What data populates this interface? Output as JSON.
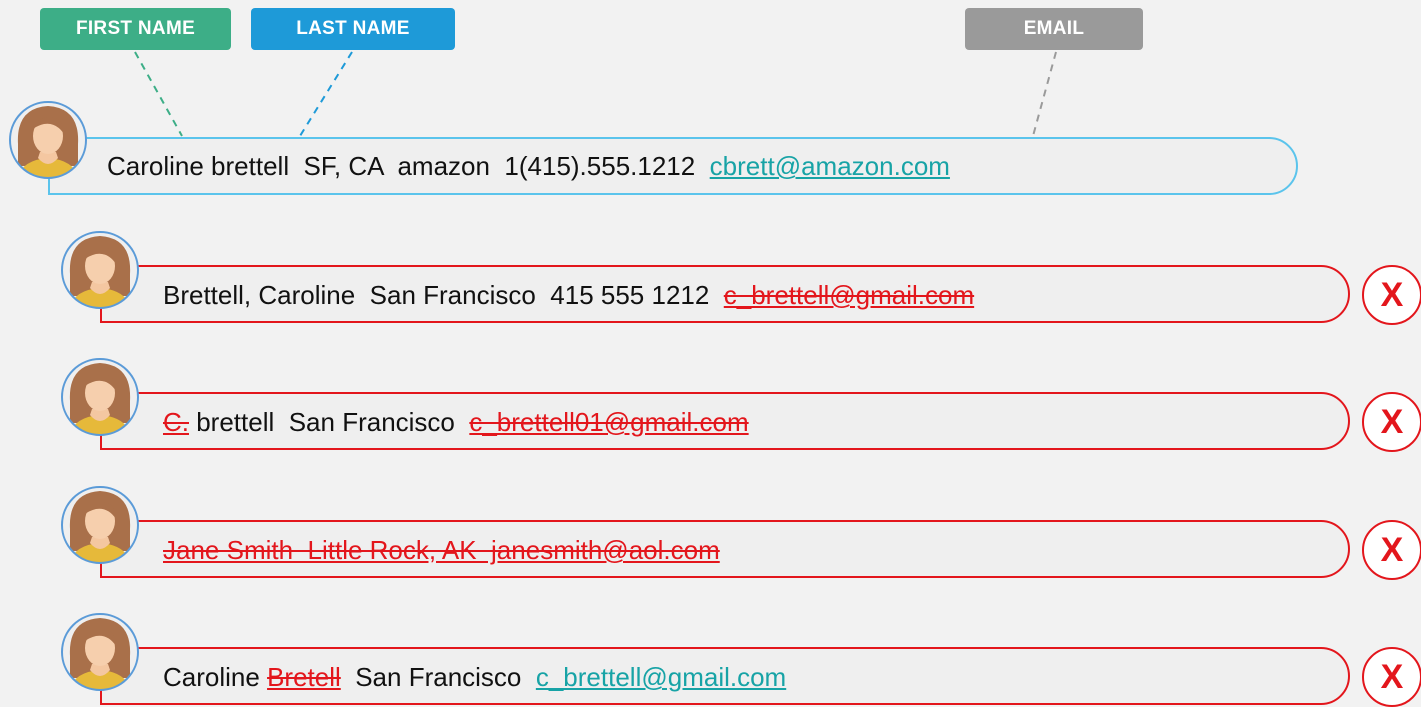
{
  "tags": {
    "first": "FIRST NAME",
    "last": "LAST NAME",
    "email": "EMAIL"
  },
  "colors": {
    "first_tag": "#3dae87",
    "last_tag": "#1e9ad8",
    "email_tag": "#9a9a9a",
    "main_border": "#5bc4ec",
    "reject": "#e3161c",
    "link": "#17a3a6"
  },
  "main_record": {
    "text": "Caroline brettell  SF, CA  amazon  1(415).555.1212  ",
    "email": "cbrett@amazon.com"
  },
  "duplicates": [
    {
      "text": "Brettell, Caroline  San Francisco  415 555 1212  ",
      "email_struck": "c_brettell@gmail.com",
      "mark": "X"
    },
    {
      "initial_struck": "C.",
      "text": " brettell  San Francisco  ",
      "email_struck": "c_brettell01@gmail.com",
      "mark": "X"
    },
    {
      "struck": "Jane Smith  Little Rock, AK  janesmith@aol.com",
      "mark": "X"
    },
    {
      "first": "Caroline ",
      "last_struck": "Bretell",
      "text": "  San Francisco  ",
      "email": "c_brettell@gmail.com",
      "mark": "X"
    }
  ],
  "icons": {
    "avatar": "woman-avatar-icon",
    "reject": "reject-x-icon"
  }
}
